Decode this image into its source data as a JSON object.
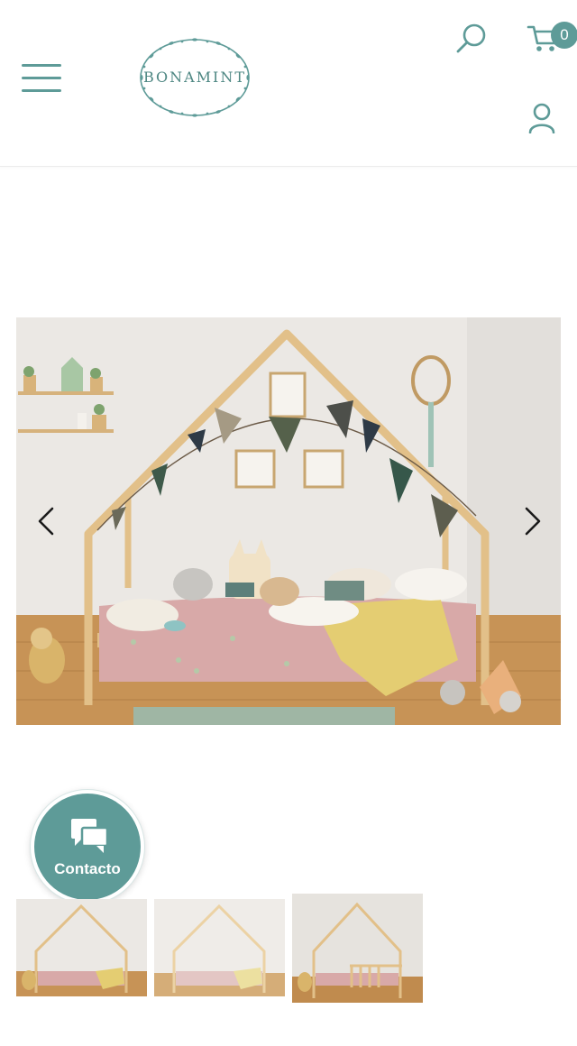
{
  "header": {
    "brand": "BONAMINT",
    "cart_count": "0",
    "icons": [
      "menu-icon",
      "search-icon",
      "cart-icon",
      "user-icon"
    ]
  },
  "gallery": {
    "main_image": "house-bed-bedroom-photo",
    "thumbnails": [
      {
        "variant": "house-bed"
      },
      {
        "variant": "house-bed-light"
      },
      {
        "variant": "house-bed-with-rail"
      }
    ]
  },
  "contact": {
    "label": "Contacto",
    "icon": "chat-icon"
  },
  "colors": {
    "accent": "#5e9b98",
    "wood": "#e2c089"
  }
}
